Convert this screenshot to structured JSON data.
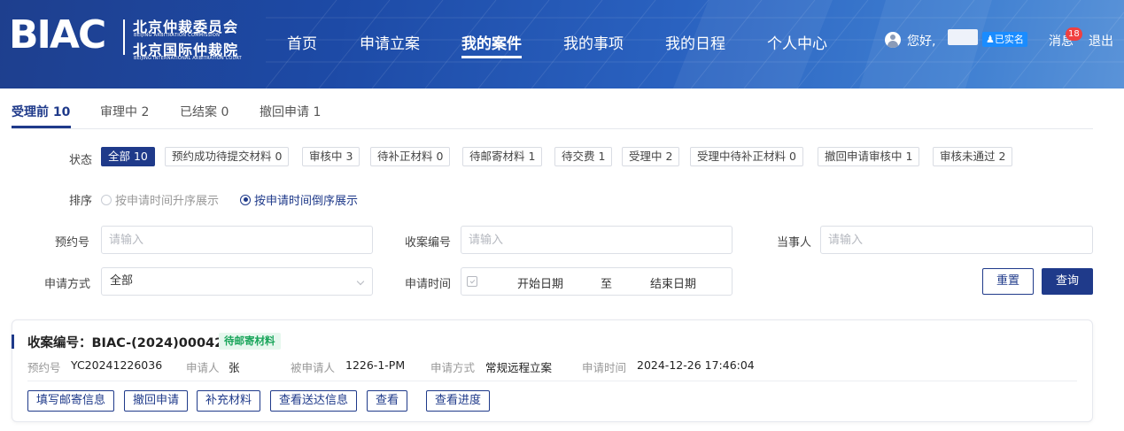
{
  "header": {
    "logo_text": "BIAC",
    "org_cn_1": "北京仲裁委员会",
    "org_en_1": "BEIJING ARBITRATION COMMISSION",
    "org_cn_2": "北京国际仲裁院",
    "org_en_2": "BEIJING INTERNATIONAL ARBITRATION COURT",
    "nav": [
      "首页",
      "申请立案",
      "我的案件",
      "我的事项",
      "我的日程",
      "个人中心"
    ],
    "active_nav": "我的案件",
    "greeting": "您好,",
    "verified_label": "已实名",
    "messages_label": "消息",
    "messages_count": "18",
    "logout_label": "退出",
    "colors": {
      "primary": "#1f3a8a",
      "badge": "#f04040",
      "verified": "#1a8cff"
    }
  },
  "tabs": [
    {
      "label": "受理前 10",
      "active": true
    },
    {
      "label": "审理中 2",
      "active": false
    },
    {
      "label": "已结案 0",
      "active": false
    },
    {
      "label": "撤回申请 1",
      "active": false
    }
  ],
  "status_filter": {
    "label": "状态",
    "chips": [
      "全部 10",
      "预约成功待提交材料 0",
      "审核中 3",
      "待补正材料 0",
      "待邮寄材料 1",
      "待交费 1",
      "受理中 2",
      "受理中待补正材料 0",
      "撤回申请审核中 1",
      "审核未通过 2"
    ],
    "selected_index": 0
  },
  "sort": {
    "label": "排序",
    "options": [
      "按申请时间升序展示",
      "按申请时间倒序展示"
    ],
    "selected_index": 1
  },
  "form": {
    "appointment_no": {
      "label": "预约号",
      "placeholder": "请输入"
    },
    "case_no": {
      "label": "收案编号",
      "placeholder": "请输入"
    },
    "party": {
      "label": "当事人",
      "placeholder": "请输入"
    },
    "apply_method": {
      "label": "申请方式",
      "value": "全部"
    },
    "apply_time": {
      "label": "申请时间",
      "start_placeholder": "开始日期",
      "separator": "至",
      "end_placeholder": "结束日期"
    },
    "reset_label": "重置",
    "query_label": "查询"
  },
  "case_card": {
    "title": "收案编号：BIAC-(2024)000426",
    "status_tag": "待邮寄材料",
    "fields": [
      {
        "key": "预约号",
        "value": "YC20241226036"
      },
      {
        "key": "申请人",
        "value": "张"
      },
      {
        "key": "被申请人",
        "value": "1226-1-PM"
      },
      {
        "key": "申请方式",
        "value": "常规远程立案"
      },
      {
        "key": "申请时间",
        "value": "2024-12-26 17:46:04"
      }
    ],
    "actions": [
      "填写邮寄信息",
      "撤回申请",
      "补充材料",
      "查看送达信息",
      "查看",
      "查看进度"
    ]
  }
}
